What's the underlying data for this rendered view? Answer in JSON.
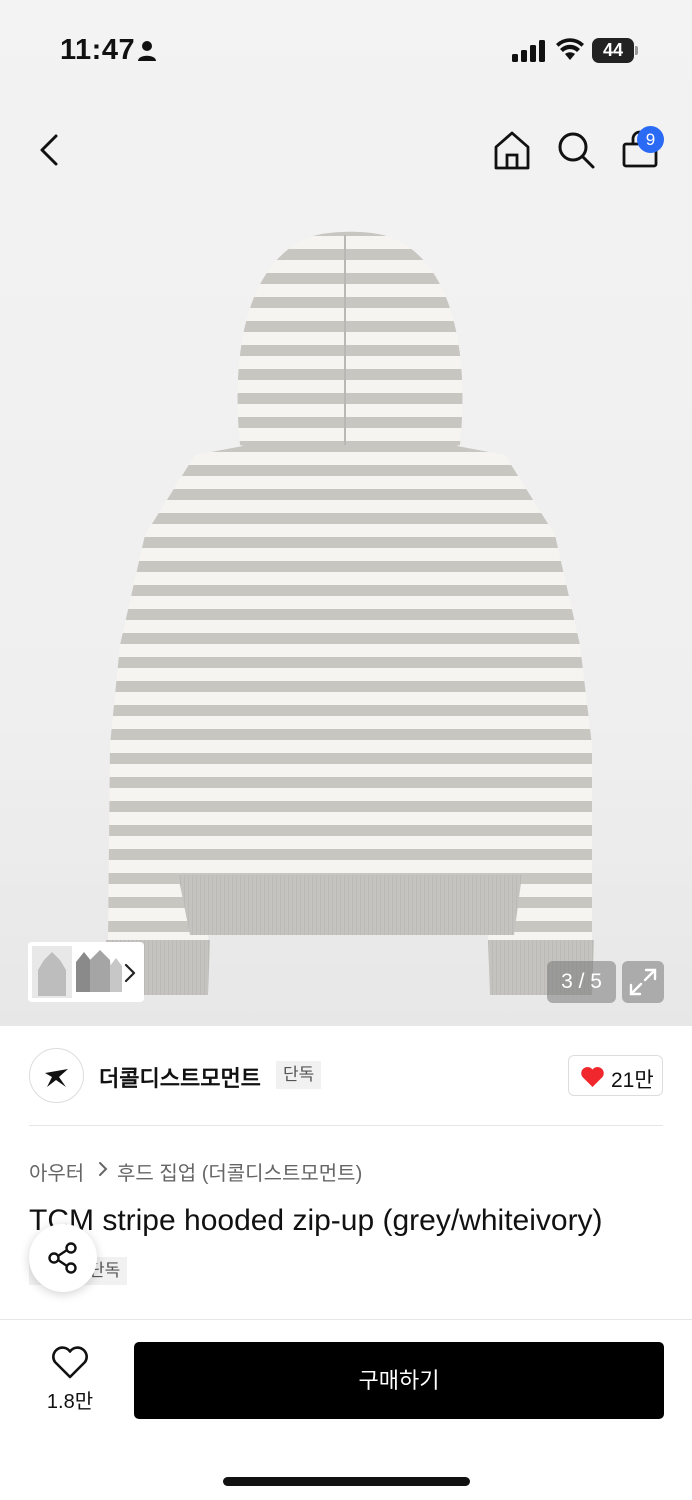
{
  "status_bar": {
    "time": "11:47",
    "battery": "44"
  },
  "header": {
    "cart_count": "9"
  },
  "gallery": {
    "page_indicator": "3 / 5"
  },
  "brand": {
    "name": "더콜디스트모먼트",
    "exclusive_tag": "단독",
    "like_count": "21만",
    "heart_color": "#f0282d"
  },
  "breadcrumb": {
    "category": "아우터",
    "subcategory": "후드 집업 (더콜디스트모먼트)"
  },
  "product": {
    "title": "TCM stripe hooded zip-up (grey/whiteivory)",
    "tag": "단독"
  },
  "bottom_bar": {
    "wishlist_count": "1.8만",
    "buy_label": "구매하기"
  },
  "colors": {
    "accent_badge": "#2a6af5",
    "buy_button": "#000000"
  }
}
